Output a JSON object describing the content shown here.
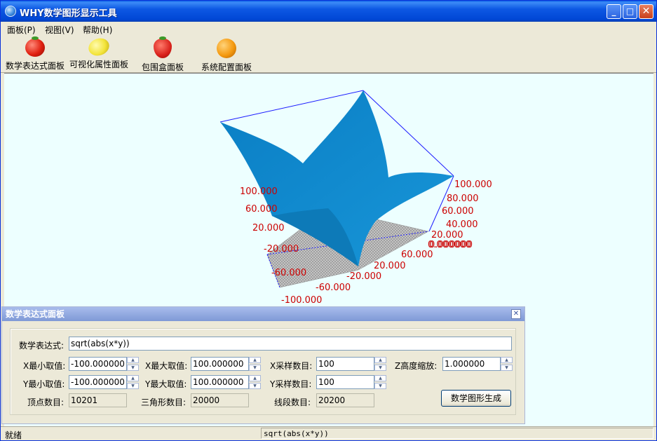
{
  "window": {
    "title": "WHY数学图形显示工具"
  },
  "menu": [
    "面板(P)",
    "视图(V)",
    "帮助(H)"
  ],
  "toolbar": [
    {
      "label": "数学表达式面板",
      "icon": "tomato-icon"
    },
    {
      "label": "可视化属性面板",
      "icon": "lemon-icon"
    },
    {
      "label": "包围盒面板",
      "icon": "strawberry-icon"
    },
    {
      "label": "系统配置面板",
      "icon": "orange-icon"
    }
  ],
  "plot": {
    "surface_color": "#1089cc",
    "bbox_color": "#1a1aff",
    "label_color": "#cc0000",
    "axis_a_labels": [
      "100.000",
      "80.000",
      "60.000",
      "40.000",
      "20.000",
      "0.000000"
    ],
    "axis_b_labels": [
      "100.000",
      "60.000",
      "20.000",
      "-20.000",
      "-60.000",
      "-100.000"
    ],
    "axis_c_labels": [
      "60.000",
      "20.000",
      "-20.000",
      "-60.000",
      "-100.000"
    ],
    "axis_c_extra": "0.000000"
  },
  "panel": {
    "title": "数学表达式面板",
    "expression_label": "数学表达式:",
    "expression": "sqrt(abs(x*y))",
    "x_min_label": "X最小取值:",
    "x_min": "-100.000000",
    "x_max_label": "X最大取值:",
    "x_max": "100.000000",
    "x_samples_label": "X采样数目:",
    "x_samples": "100",
    "z_scale_label": "Z高度缩放:",
    "z_scale": "1.000000",
    "y_min_label": "Y最小取值:",
    "y_min": "-100.000000",
    "y_max_label": "Y最大取值:",
    "y_max": "100.000000",
    "y_samples_label": "Y采样数目:",
    "y_samples": "100",
    "vertices_label": "顶点数目:",
    "vertices": "10201",
    "triangles_label": "三角形数目:",
    "triangles": "20000",
    "segments_label": "线段数目:",
    "segments": "20200",
    "generate_button": "数学图形生成"
  },
  "status": {
    "left": "就绪",
    "right": "sqrt(abs(x*y))"
  }
}
